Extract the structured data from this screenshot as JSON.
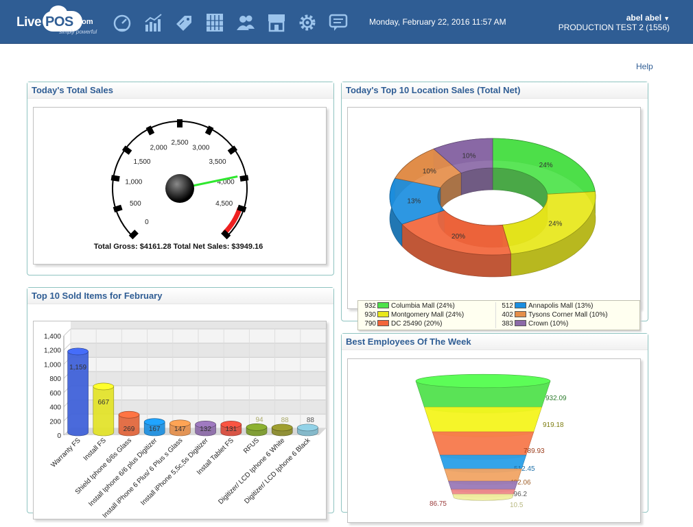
{
  "header": {
    "logo_live": "Live",
    "logo_pos": "POS",
    "logo_com": ".com",
    "logo_tagline": "simply powerful",
    "datetime": "Monday, February 22, 2016 11:57 AM",
    "user_name": "abel abel",
    "store": "PRODUCTION TEST 2 (1556)",
    "nav_icons": [
      "dashboard-icon",
      "reports-chart-icon",
      "pricing-tag-icon",
      "inventory-icon",
      "customers-icon",
      "store-icon",
      "settings-gear-icon",
      "messages-icon"
    ]
  },
  "help_label": "Help",
  "colors": {
    "header_bg": "#2f5d94",
    "panel_title": "#2f5d94",
    "panel_border": "#8ec3c0"
  },
  "panels": {
    "sales_title": "Today's Total Sales",
    "locations_title": "Today's Top 10 Location Sales (Total Net)",
    "items_title": "Top 10 Sold Items for February",
    "employees_title": "Best Employees Of The Week"
  },
  "gauge": {
    "ticks": [
      "0",
      "500",
      "1,000",
      "1,500",
      "2,000",
      "2,500",
      "3,000",
      "3,500",
      "4,000",
      "4,500"
    ],
    "min": 0,
    "max": 5000,
    "value": 3949.16,
    "red_from": 4500,
    "caption": "Total Gross: $4161.28  Total Net Sales: $3949.16"
  },
  "chart_data": [
    {
      "type": "pie",
      "title": "Today's Top 10 Location Sales (Total Net)",
      "labels": [
        "Columbia Mall",
        "Montgomery Mall",
        "DC 25490",
        "Annapolis Mall",
        "Tysons Corner Mall",
        "Crown"
      ],
      "values": [
        932,
        930,
        790,
        512,
        402,
        383
      ],
      "percent_labels": [
        "24%",
        "24%",
        "20%",
        "13%",
        "10%",
        "10%"
      ],
      "legend": [
        {
          "value": "932",
          "label": "Columbia Mall (24%)",
          "color": "#4ee34a"
        },
        {
          "value": "930",
          "label": "Montgomery Mall (24%)",
          "color": "#e8e81a"
        },
        {
          "value": "790",
          "label": "DC 25490 (20%)",
          "color": "#f2653a"
        },
        {
          "value": "512",
          "label": "Annapolis Mall (13%)",
          "color": "#1c8fe0"
        },
        {
          "value": "402",
          "label": "Tysons Corner Mall (10%)",
          "color": "#e58f4a"
        },
        {
          "value": "383",
          "label": "Crown (10%)",
          "color": "#8b6aa8"
        }
      ],
      "legend_placement": "bottom"
    },
    {
      "type": "bar",
      "title": "Top 10 Sold Items for February",
      "categories": [
        "Warranty FS",
        "Install FS",
        "Shield Iphone 6/6s Glass",
        "Install Iphone 6/6 plus Digitizer",
        "Install iPhone 6 Plus/ 6 Plus s Glass",
        "Install iPhone 5,5c,5s Digitizer",
        "Install Tablet FS",
        "RFUS",
        "Digitizer/ LCD  Iphone 6 White",
        "Digitizer/ LCD  Iphone 6 Black"
      ],
      "values": [
        1159,
        667,
        269,
        167,
        147,
        132,
        131,
        94,
        88,
        88
      ],
      "value_labels": [
        "1,159",
        "667",
        "269",
        "167",
        "147",
        "132",
        "131",
        "94",
        "88",
        "88"
      ],
      "colors": [
        "#3c5fd9",
        "#e3e327",
        "#e2653a",
        "#1c8fe0",
        "#e58f4a",
        "#8b6aa8",
        "#d94a3a",
        "#7a9a2a",
        "#8a8a2a",
        "#7fb7c9"
      ],
      "yticks": [
        "0",
        "200",
        "400",
        "600",
        "800",
        "1,000",
        "1,200",
        "1,400"
      ],
      "ylim": [
        0,
        1400
      ],
      "grid": true
    },
    {
      "type": "funnel",
      "title": "Best Employees Of The Week",
      "values": [
        932.09,
        919.18,
        789.93,
        512.45,
        402.06,
        296.2,
        86.75,
        10.5
      ],
      "value_labels": [
        "932.09",
        "919.18",
        "789.93",
        "512.45",
        "402.06",
        "296.2",
        "86.75",
        "10.5"
      ],
      "colors": [
        "#52e24e",
        "#f5f51e",
        "#f77a4c",
        "#2aa0e8",
        "#f2a565",
        "#9a7ab8",
        "#f08a8a",
        "#f0f0a0"
      ]
    }
  ]
}
